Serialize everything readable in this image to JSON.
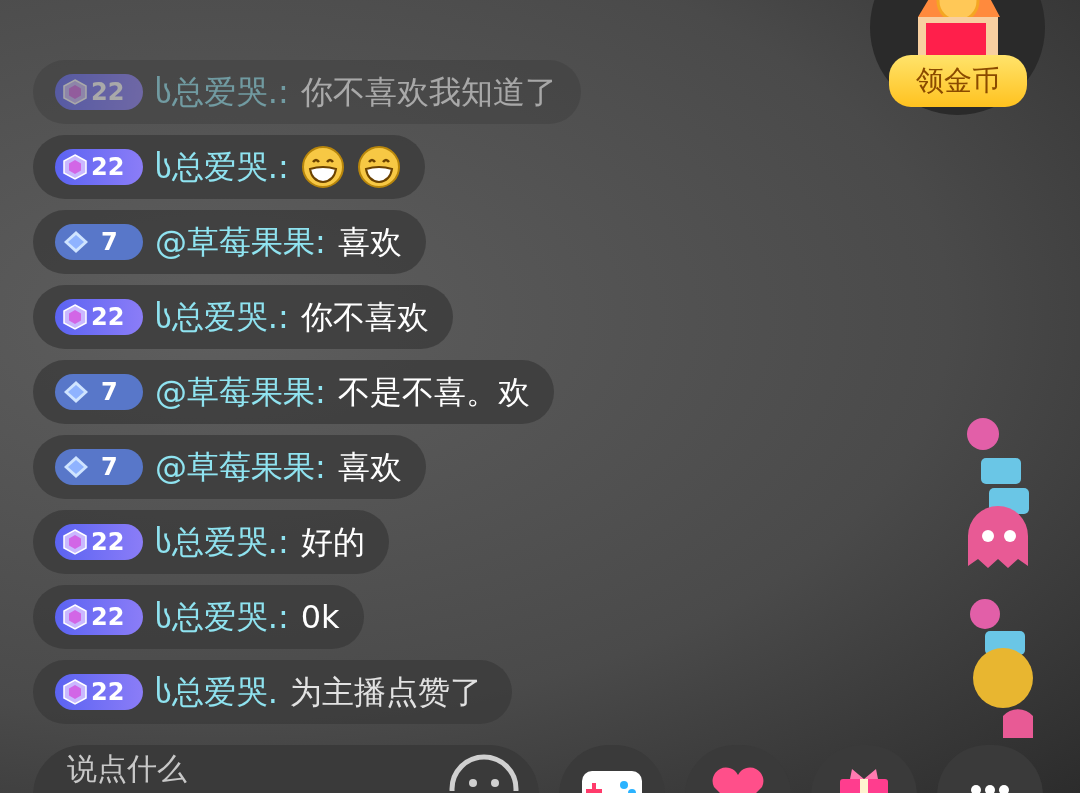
{
  "messages": [
    {
      "badge": {
        "kind": "hex",
        "level": "22"
      },
      "name": "ს总爱哭.:",
      "text": "你不喜欢我知道了",
      "faded": true,
      "kind": "chat"
    },
    {
      "badge": {
        "kind": "hex",
        "level": "22"
      },
      "name": "ს总爱哭.:",
      "emojis": [
        {
          "kind": "grin"
        },
        {
          "kind": "grin"
        }
      ],
      "faded": false,
      "kind": "chat"
    },
    {
      "badge": {
        "kind": "diamond",
        "level": "7"
      },
      "name": "@草莓果果:",
      "text": "喜欢",
      "faded": false,
      "kind": "chat"
    },
    {
      "badge": {
        "kind": "hex",
        "level": "22"
      },
      "name": "ს总爱哭.:",
      "text": "你不喜欢",
      "faded": false,
      "kind": "chat"
    },
    {
      "badge": {
        "kind": "diamond",
        "level": "7"
      },
      "name": "@草莓果果:",
      "text": "不是不喜。欢",
      "faded": false,
      "kind": "chat"
    },
    {
      "badge": {
        "kind": "diamond",
        "level": "7"
      },
      "name": "@草莓果果:",
      "text": "喜欢",
      "faded": false,
      "kind": "chat"
    },
    {
      "badge": {
        "kind": "hex",
        "level": "22"
      },
      "name": "ს总爱哭.:",
      "text": "好的",
      "faded": false,
      "kind": "chat"
    },
    {
      "badge": {
        "kind": "hex",
        "level": "22"
      },
      "name": "ს总爱哭.:",
      "text": "0k",
      "faded": false,
      "kind": "chat"
    },
    {
      "badge": {
        "kind": "hex",
        "level": "22"
      },
      "name": "ს总爱哭.",
      "text": "为主播点赞了",
      "faded": false,
      "kind": "system"
    }
  ],
  "coin_widget": {
    "label": "领金币"
  },
  "input": {
    "placeholder": "说点什么"
  },
  "actions": [
    {
      "kind": "game"
    },
    {
      "kind": "heart"
    },
    {
      "kind": "gift"
    },
    {
      "kind": "more"
    }
  ]
}
